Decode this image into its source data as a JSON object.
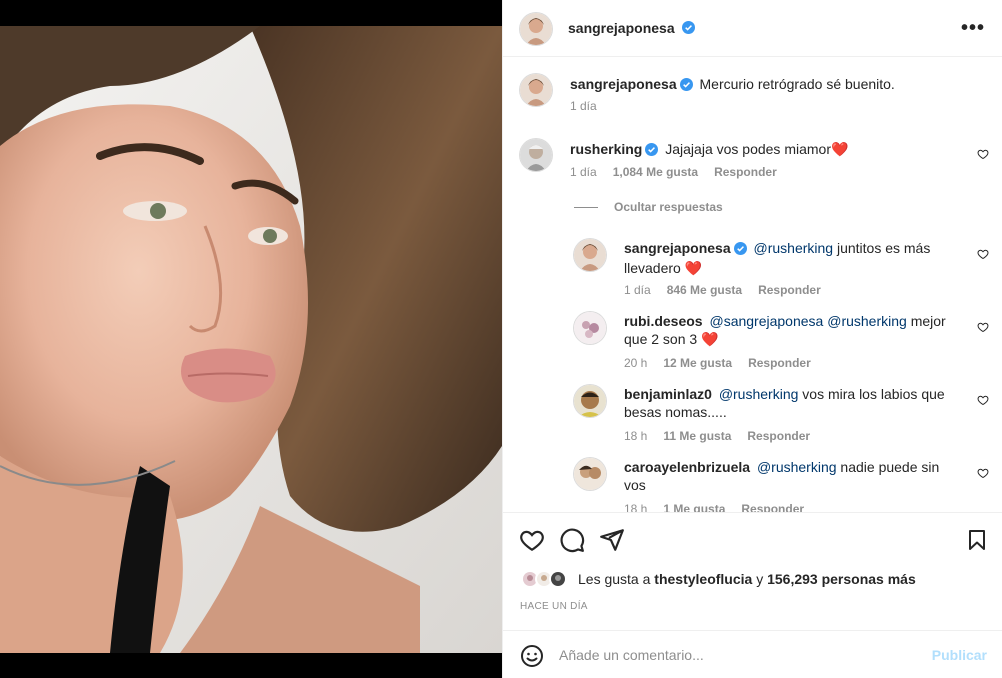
{
  "post": {
    "author": "sangrejaponesa",
    "more_icon": "more-horizontal-icon"
  },
  "caption": {
    "author": "sangrejaponesa",
    "text": "Mercurio retrógrado sé buenito.",
    "time": "1 día"
  },
  "comments": [
    {
      "user": "rusherking",
      "verified": true,
      "text": "Jajajaja vos podes miamor❤️",
      "time": "1 día",
      "likes": "1,084 Me gusta",
      "reply": "Responder"
    }
  ],
  "hide_replies_label": "Ocultar respuestas",
  "replies": [
    {
      "user": "sangrejaponesa",
      "verified": true,
      "mention": "@rusherking",
      "text_line1": " juntitos es más",
      "text_line2": "llevadero ❤️",
      "time": "1 día",
      "likes": "846 Me gusta",
      "reply": "Responder"
    },
    {
      "user": "rubi.deseos",
      "mention": "@sangrejaponesa",
      "mention2": "@rusherking",
      "text_line1": " mejor",
      "text_line2": "que 2 son 3 ❤️",
      "time": "20 h",
      "likes": "12 Me gusta",
      "reply": "Responder"
    },
    {
      "user": "benjaminlaz0",
      "mention": "@rusherking",
      "text_line1": " vos mira los labios que",
      "text_line2": "besas nomas.....",
      "time": "18 h",
      "likes": "11 Me gusta",
      "reply": "Responder"
    },
    {
      "user": "caroayelenbrizuela",
      "mention": "@rusherking",
      "text_line1": " nadie puede sin",
      "text_line2": "vos",
      "time": "18 h",
      "likes": "1 Me gusta",
      "reply": "Responder"
    }
  ],
  "likes": {
    "prefix": "Les gusta a",
    "first_user": "thestyleoflucia",
    "connector": "y",
    "others": "156,293 personas más"
  },
  "time_ago": "HACE UN DÍA",
  "add_comment": {
    "placeholder": "Añade un comentario...",
    "publish_label": "Publicar"
  },
  "colors": {
    "verified": "#3897f0",
    "heart_red": "#ed4956",
    "mention": "#00376b",
    "publish_disabled": "#b2dffc"
  }
}
